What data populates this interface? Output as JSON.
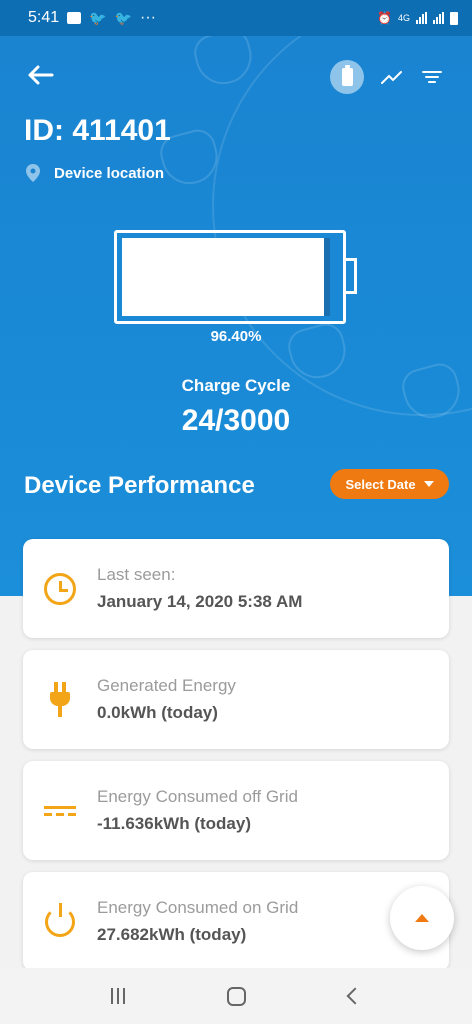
{
  "status_bar": {
    "time": "5:41",
    "dots": "···",
    "network": "4G"
  },
  "header": {
    "device_id": "ID: 411401",
    "location_label": "Device location"
  },
  "battery": {
    "percent_text": "96.40%",
    "level_fraction": 0.964,
    "charge_cycle_label": "Charge Cycle",
    "charge_cycle_value": "24/3000"
  },
  "performance": {
    "title": "Device Performance",
    "select_date_label": "Select Date"
  },
  "cards": [
    {
      "label": "Last seen:",
      "value": "January 14, 2020 5:38 AM",
      "icon": "clock-icon"
    },
    {
      "label": "Generated Energy",
      "value": "0.0kWh (today)",
      "icon": "plug-icon"
    },
    {
      "label": "Energy Consumed off Grid",
      "value": "-11.636kWh (today)",
      "icon": "dc-current-icon"
    },
    {
      "label": "Energy Consumed on Grid",
      "value": "27.682kWh (today)",
      "icon": "power-icon"
    }
  ],
  "colors": {
    "primary_blue": "#1a84d1",
    "accent_orange": "#f07a12",
    "icon_yellow": "#f2a516"
  }
}
